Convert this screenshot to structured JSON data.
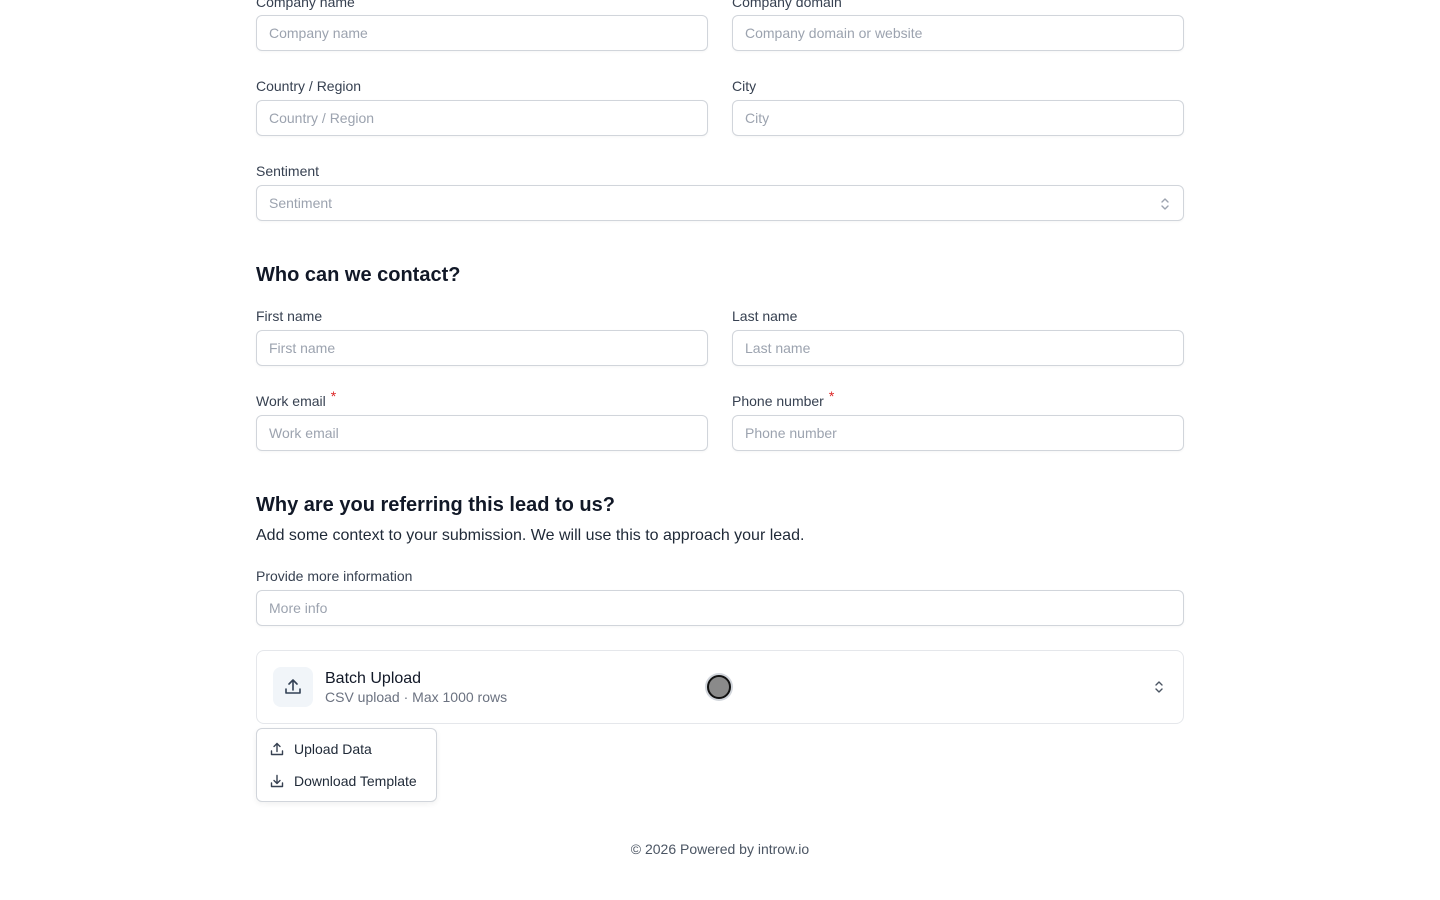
{
  "company": {
    "name_label": "Company name",
    "name_placeholder": "Company name",
    "domain_label": "Company domain",
    "domain_placeholder": "Company domain or website"
  },
  "location": {
    "country_label": "Country / Region",
    "country_placeholder": "Country / Region",
    "city_label": "City",
    "city_placeholder": "City"
  },
  "sentiment": {
    "label": "Sentiment",
    "placeholder": "Sentiment"
  },
  "contact": {
    "heading": "Who can we contact?",
    "first_name_label": "First name",
    "first_name_placeholder": "First name",
    "last_name_label": "Last name",
    "last_name_placeholder": "Last name",
    "email_label": "Work email",
    "email_placeholder": "Work email",
    "phone_label": "Phone number",
    "phone_placeholder": "Phone number",
    "required_mark": "*"
  },
  "referral": {
    "heading": "Why are you referring this lead to us?",
    "subtext": "Add some context to your submission. We will use this to approach your lead.",
    "info_label": "Provide more information",
    "info_placeholder": "More info"
  },
  "batch": {
    "title": "Batch Upload",
    "subtitle": "CSV upload · Max 1000 rows",
    "menu": [
      {
        "label": "Upload Data",
        "icon": "upload-icon"
      },
      {
        "label": "Download Template",
        "icon": "download-icon"
      }
    ]
  },
  "footer": {
    "text": "© 2026 Powered by introw.io"
  },
  "colors": {
    "required": "#dc2626",
    "border": "#d1d5db",
    "placeholder": "#9ca3af"
  }
}
